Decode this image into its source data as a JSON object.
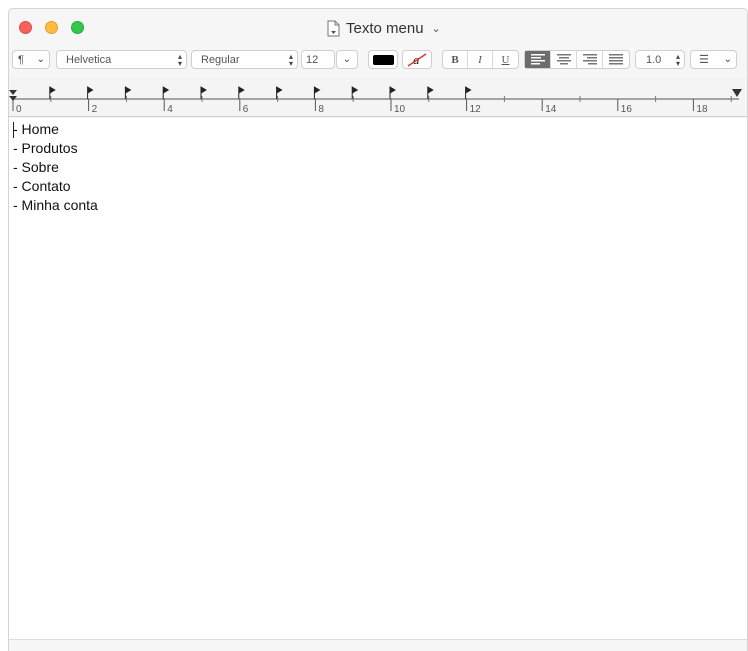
{
  "window": {
    "title": "Texto menu",
    "title_chevron": "⌄"
  },
  "toolbar": {
    "paragraph_style": "¶",
    "font_family": "Helvetica",
    "font_style": "Regular",
    "font_size": "12",
    "text_color": "#000000",
    "highlight_label": "a",
    "bold": "B",
    "italic": "I",
    "underline": "U",
    "line_spacing": "1.0",
    "list_label": "☰"
  },
  "ruler": {
    "labels": [
      "0",
      "2",
      "4",
      "6",
      "8",
      "10",
      "12",
      "14",
      "16",
      "18"
    ]
  },
  "document": {
    "lines": [
      "- Home",
      "- Produtos",
      "- Sobre",
      "- Contato",
      "- Minha conta"
    ]
  }
}
